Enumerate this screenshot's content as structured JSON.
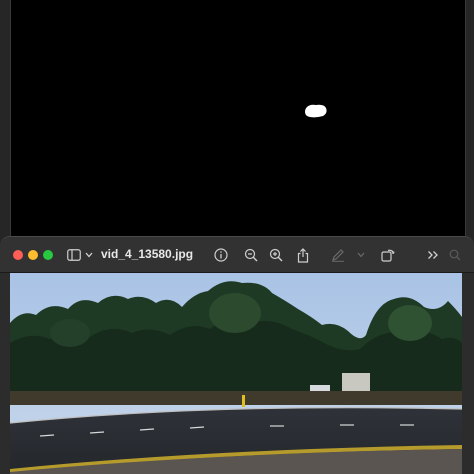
{
  "back_window": {
    "image_name": "segmentation-mask"
  },
  "front_window": {
    "title": "vid_4_13580.jpg",
    "toolbar": {
      "sidebar_icon": "sidebar-icon",
      "chevron_icon": "chevron-down-icon",
      "info_icon": "info-icon",
      "zoom_out_icon": "zoom-out-icon",
      "zoom_in_icon": "zoom-in-icon",
      "share_icon": "share-icon",
      "markup_icon": "pencil-icon",
      "rotate_icon": "rotate-icon",
      "more_icon": "double-chevron-right-icon",
      "search_icon": "search-icon"
    },
    "image": {
      "subject": "street-scene-photo"
    }
  },
  "colors": {
    "close": "#ff5f57",
    "minimize": "#febc2e",
    "maximize": "#28c840"
  }
}
